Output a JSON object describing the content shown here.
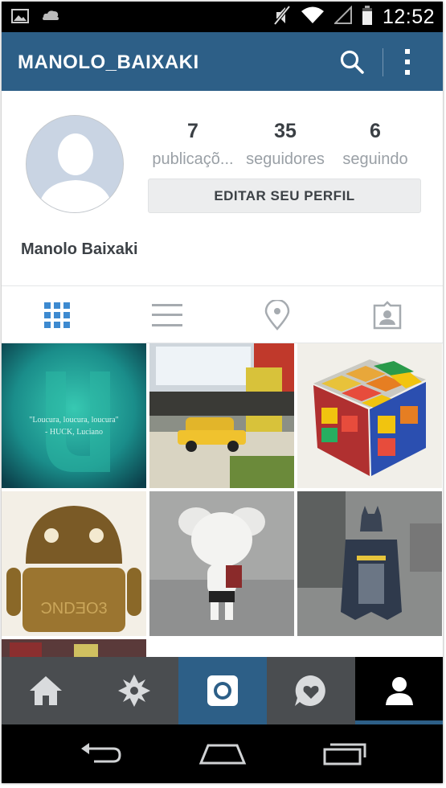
{
  "status_bar": {
    "time": "12:52",
    "icons": [
      "gallery-icon",
      "cloud-icon",
      "mute-icon",
      "wifi-icon",
      "signal-icon",
      "battery-icon"
    ]
  },
  "app_bar": {
    "title": "MANOLO_BAIXAKI",
    "icons": [
      "search-icon",
      "more-vert-icon"
    ]
  },
  "profile": {
    "avatar_icon": "default-avatar-icon",
    "stats": [
      {
        "value": "7",
        "label": "publicaçõ..."
      },
      {
        "value": "35",
        "label": "seguidores"
      },
      {
        "value": "6",
        "label": "seguindo"
      }
    ],
    "edit_button": "EDITAR SEU PERFIL",
    "full_name": "Manolo Baixaki"
  },
  "view_tabs": [
    {
      "icon": "grid-icon",
      "active": true
    },
    {
      "icon": "list-icon",
      "active": false
    },
    {
      "icon": "location-pin-icon",
      "active": false
    },
    {
      "icon": "tagged-photos-icon",
      "active": false
    }
  ],
  "photos": [
    {
      "subject": "teal-quote-image",
      "caption_line1": "\"Loucura, loucura, loucura\"",
      "caption_line2": "- HUCK, Luciano"
    },
    {
      "subject": "toy-taxi-on-desk"
    },
    {
      "subject": "rubiks-cube"
    },
    {
      "subject": "android-figure"
    },
    {
      "subject": "white-vinyl-figure"
    },
    {
      "subject": "batman-figure"
    },
    {
      "subject": "partial-photo"
    }
  ],
  "bottom_nav": [
    {
      "icon": "home-icon"
    },
    {
      "icon": "explore-icon"
    },
    {
      "icon": "camera-icon",
      "active": false
    },
    {
      "icon": "activity-icon"
    },
    {
      "icon": "profile-icon",
      "active": true
    }
  ],
  "system_nav": [
    "back-icon",
    "home-button-icon",
    "recents-icon"
  ],
  "colors": {
    "app_bar": "#2d5f87",
    "bottom_nav": "#4a4d50",
    "active_tab_icon": "#3d8ad0",
    "inactive_tab_icon": "#a6abb0"
  }
}
